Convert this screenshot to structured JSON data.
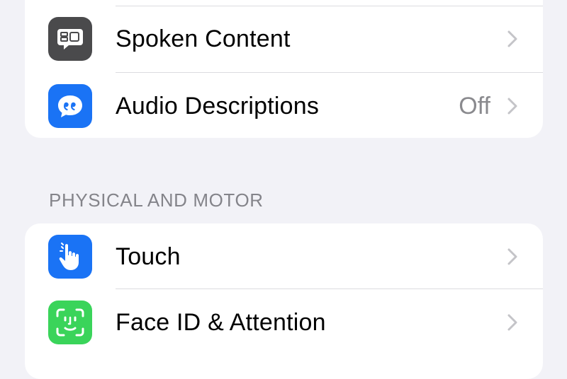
{
  "groups": {
    "vision": {
      "items": [
        {
          "label": "Spoken Content",
          "value": "",
          "icon": "speech-bubble-icon",
          "icon_color": "#4a4a4c"
        },
        {
          "label": "Audio Descriptions",
          "value": "Off",
          "icon": "quote-bubble-icon",
          "icon_color": "#1a73f5"
        }
      ]
    },
    "physical": {
      "header": "PHYSICAL AND MOTOR",
      "items": [
        {
          "label": "Touch",
          "value": "",
          "icon": "hand-pointer-icon",
          "icon_color": "#1a73f5"
        },
        {
          "label": "Face ID & Attention",
          "value": "",
          "icon": "face-id-icon",
          "icon_color": "#3ad45a"
        }
      ]
    }
  }
}
